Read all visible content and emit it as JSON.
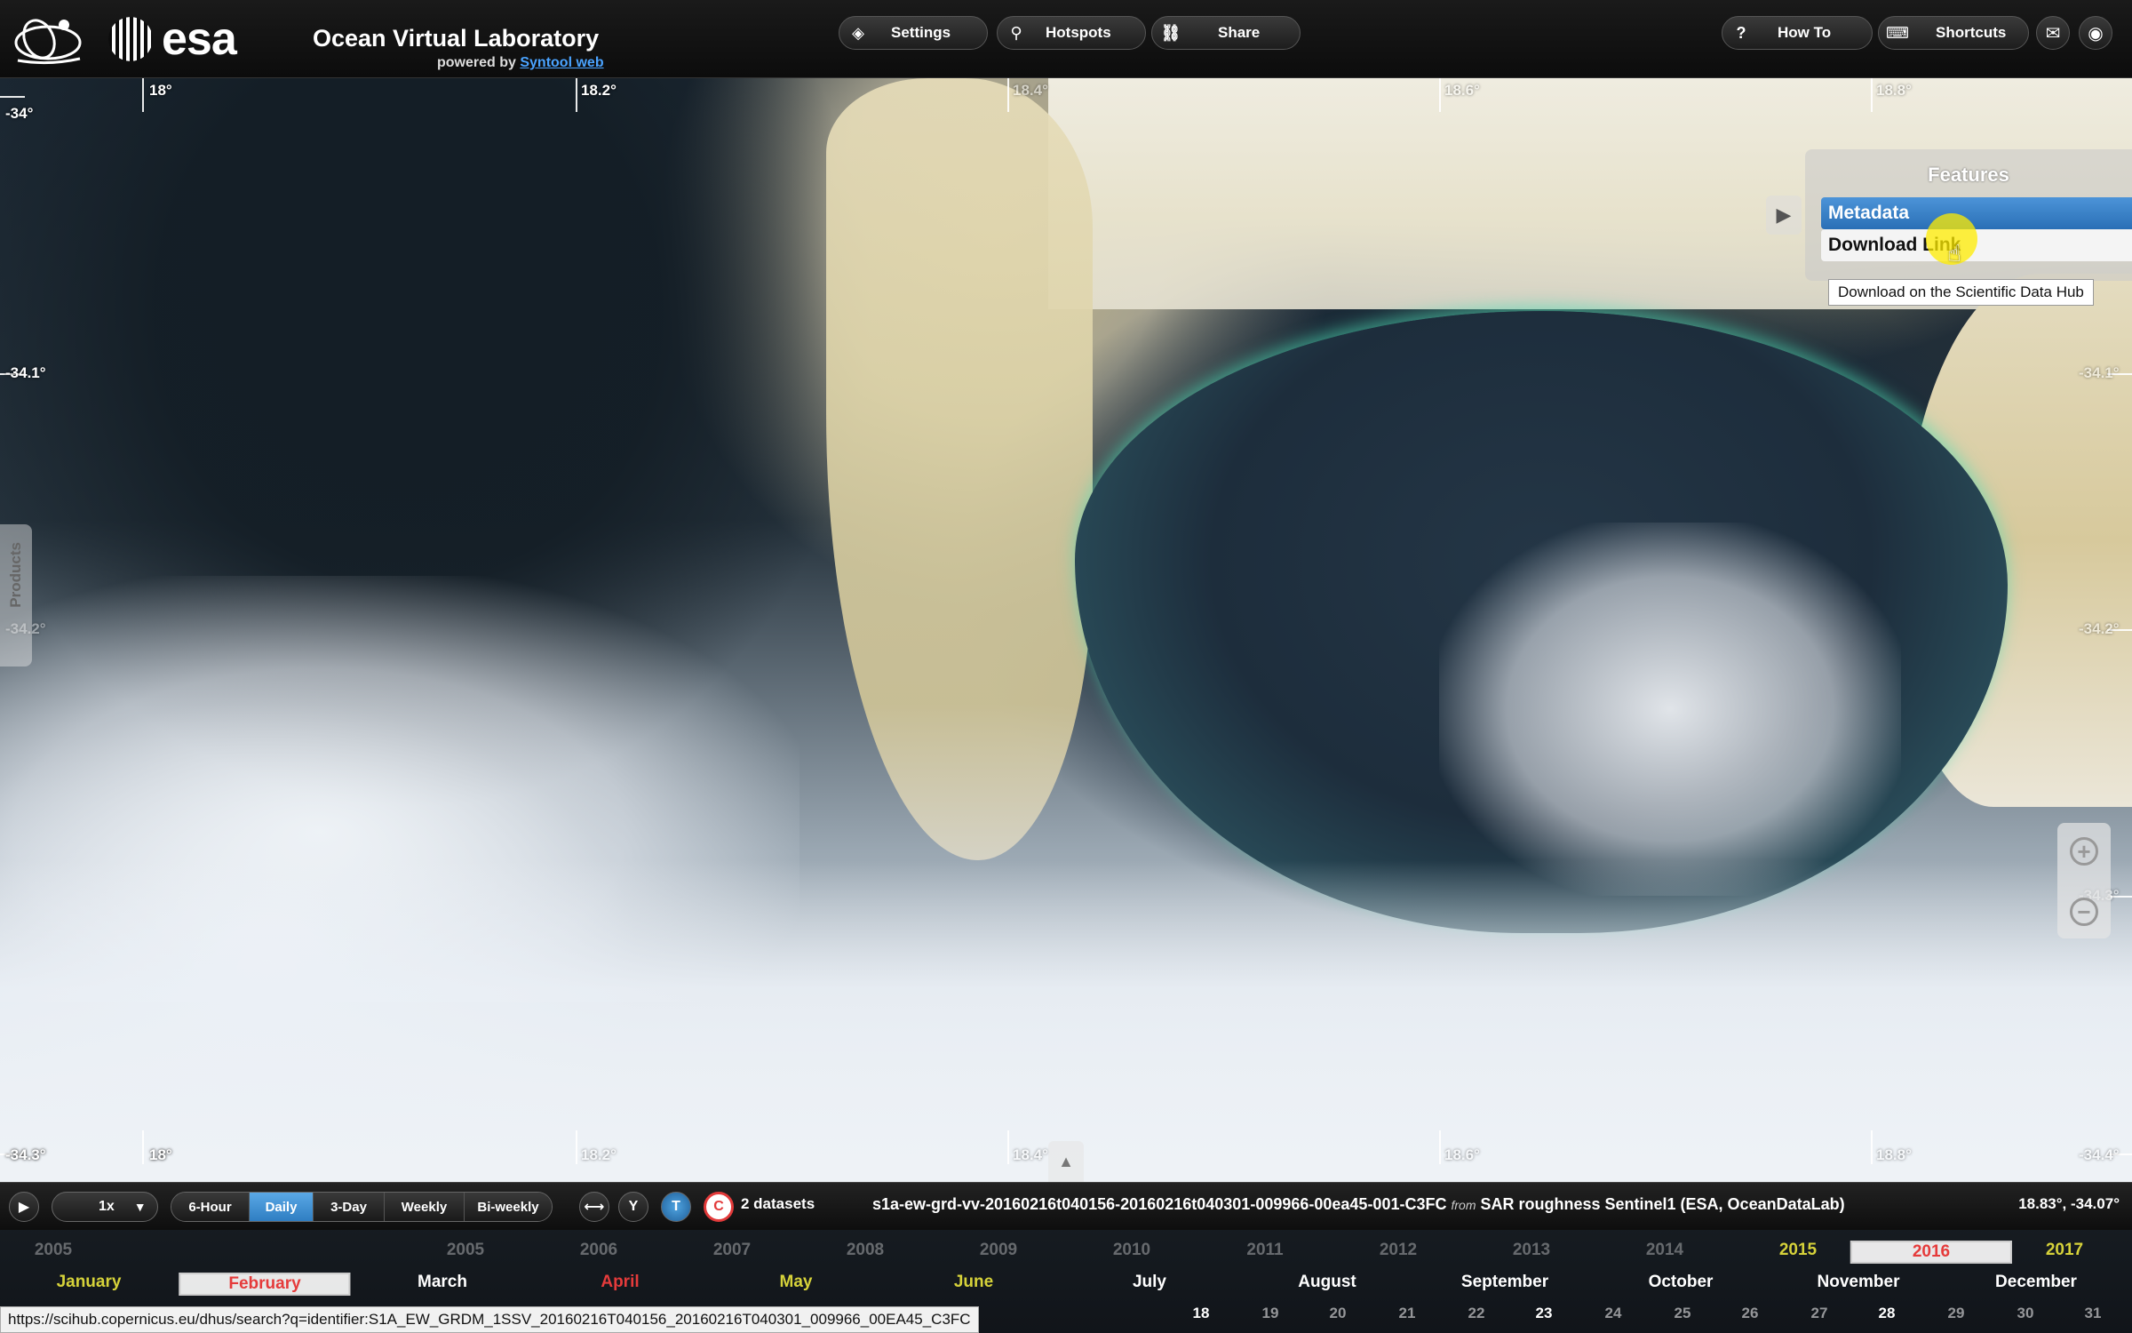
{
  "header": {
    "app_title": "Ocean Virtual Laboratory",
    "powered_by_prefix": "powered by",
    "powered_by_link": "Syntool web",
    "brand_word": "esa",
    "buttons": {
      "settings": "Settings",
      "hotspots": "Hotspots",
      "share": "Share",
      "how_to": "How To",
      "shortcuts": "Shortcuts"
    },
    "icons": {
      "settings": "layers-icon",
      "hotspots": "map-pin-icon",
      "share": "link-icon",
      "how_to": "question-icon",
      "shortcuts": "keyboard-icon",
      "mail": "mail-icon",
      "globe": "globe-icon"
    }
  },
  "map": {
    "lon_labels_top": [
      "18°",
      "18.2°",
      "18.4°",
      "18.6°",
      "18.8°"
    ],
    "lon_labels_bottom": [
      "18°",
      "18.2°",
      "18.4°",
      "18.6°",
      "18.8°"
    ],
    "lat_labels_left": [
      "-34°",
      "-34.1°",
      "-34.2°",
      "-34.3°"
    ],
    "lat_labels_right": [
      "-34.1°",
      "-34.2°",
      "-34.3°",
      "-34.4°"
    ],
    "products_tab": "Products"
  },
  "features": {
    "title": "Features",
    "items": [
      "Metadata",
      "Download Link"
    ],
    "tooltip": "Download on the Scientific Data Hub"
  },
  "bottombar": {
    "speed": "1x",
    "intervals": [
      "6-Hour",
      "Daily",
      "3-Day",
      "Weekly",
      "Bi-weekly"
    ],
    "active_interval": "Daily",
    "datasets": "2 datasets",
    "product_id": "s1a-ew-grd-vv-20160216t040156-20160216t040301-009966-00ea45-001-C3FC",
    "from_word": "from",
    "product_source": "SAR roughness Sentinel1 (ESA, OceanDataLab)",
    "coordinates": "18.83°, -34.07°"
  },
  "timeline": {
    "years": [
      "2005",
      "2006",
      "2007",
      "2008",
      "2009",
      "2010",
      "2011",
      "2012",
      "2013",
      "2014",
      "2015",
      "2016",
      "2017"
    ],
    "selected_year": "2016",
    "months": [
      "January",
      "February",
      "March",
      "April",
      "May",
      "June",
      "July",
      "August",
      "September",
      "October",
      "November",
      "December"
    ],
    "selected_month": "February",
    "days": [
      "18",
      "19",
      "20",
      "21",
      "22",
      "23",
      "24",
      "25",
      "26",
      "27",
      "28",
      "29",
      "30",
      "31"
    ],
    "status_url": "https://scihub.copernicus.eu/dhus/search?q=identifier:S1A_EW_GRDM_1SSV_20160216T040156_20160216T040301_009966_00EA45_C3FC"
  },
  "colors": {
    "accent_blue": "#2f7ec2",
    "highlight_red": "#e53b3b",
    "highlight_yellow": "#d6d23a"
  }
}
